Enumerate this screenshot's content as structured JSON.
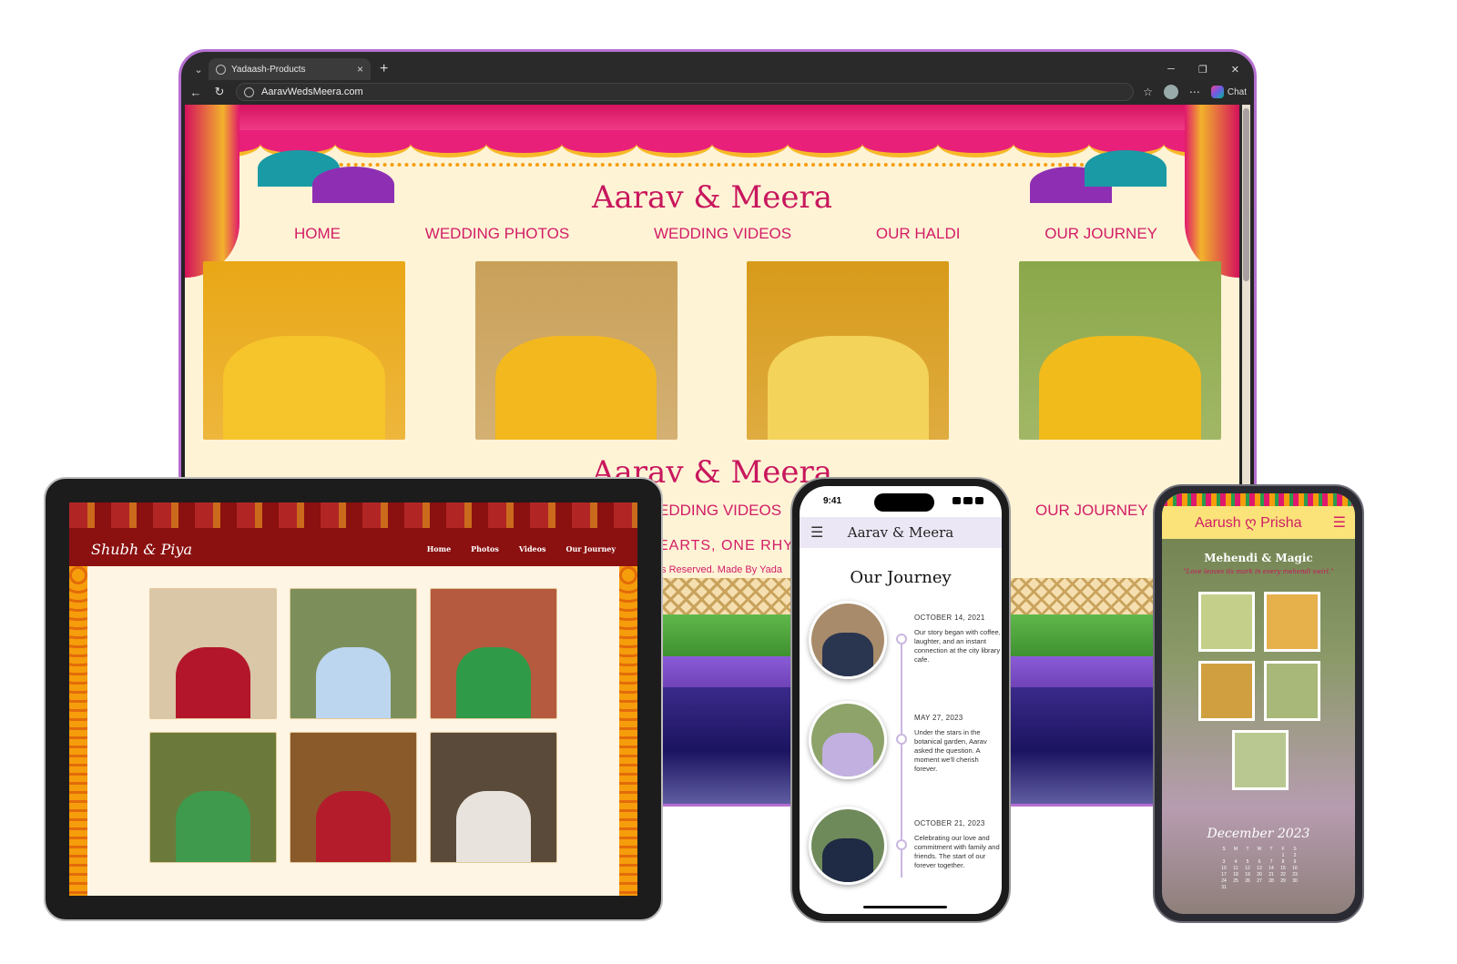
{
  "browser": {
    "tab_title": "Yadaash-Products",
    "url": "AaravWedsMeera.com",
    "chat_label": "Chat"
  },
  "desktop_site": {
    "title": "Aarav & Meera",
    "nav": [
      "HOME",
      "WEDDING PHOTOS",
      "WEDDING VIDEOS",
      "OUR HALDI",
      "OUR JOURNEY"
    ],
    "photos": [
      {
        "bg": "#e9a716",
        "fig": "#f6c42b"
      },
      {
        "bg": "#c9a05a",
        "fig": "#f2b81e"
      },
      {
        "bg": "#d79a1a",
        "fig": "#f4d35a"
      },
      {
        "bg": "#8aa84a",
        "fig": "#f1bb1c"
      }
    ],
    "title_repeat": "Aarav & Meera",
    "nav_repeat_left": "EDDING VIDEOS",
    "nav_repeat_right": "OUR JOURNEY",
    "tagline_fragment": "EARTS, ONE RHYT",
    "rights_fragment": "ts Reserved. Made By Yada"
  },
  "tablet_site": {
    "brand": "Shubh & Piya",
    "nav": [
      "Home",
      "Photos",
      "Videos",
      "Our Journey"
    ],
    "photos": [
      {
        "bg": "#d9c7a8",
        "fig": "#b3162b"
      },
      {
        "bg": "#7c8f5a",
        "fig": "#bcd6f0"
      },
      {
        "bg": "#b55a3f",
        "fig": "#2f9a48"
      },
      {
        "bg": "#6b7a3a",
        "fig": "#3f9a4e"
      },
      {
        "bg": "#8a5a2a",
        "fig": "#b41c2c"
      },
      {
        "bg": "#5a4a3a",
        "fig": "#e8e3dc"
      }
    ]
  },
  "phone_journey": {
    "time": "9:41",
    "title": "Aarav & Meera",
    "heading": "Our Journey",
    "items": [
      {
        "date": "OCTOBER 14, 2021",
        "text": "Our story began with coffee, laughter, and an instant connection at the city library cafe.",
        "bg": "#a88b6a",
        "fig": "#2a3550"
      },
      {
        "date": "MAY 27, 2023",
        "text": "Under the stars in the botanical garden, Aarav asked the question. A moment we'll cherish forever.",
        "bg": "#8ea36a",
        "fig": "#c2b0e0"
      },
      {
        "date": "OCTOBER 21, 2023",
        "text": "Celebrating our love and commitment with family and friends. The start of our forever together.",
        "bg": "#6f8a5a",
        "fig": "#1f2a44"
      }
    ]
  },
  "phone_mehendi": {
    "title": "Aarush ღ Prisha",
    "subtitle": "Mehendi & Magic",
    "quote": "\"Love leaves its mark in every mehendi swirl.\"",
    "photos": [
      "#c4d08a",
      "#e6b04a",
      "#d0a040",
      "#a8b878"
    ],
    "single_photo": "#b8c890",
    "month": "December 2023",
    "calendar": [
      "S",
      "M",
      "T",
      "W",
      "T",
      "F",
      "S",
      "",
      "",
      "",
      "",
      "",
      "1",
      "2",
      "3",
      "4",
      "5",
      "6",
      "7",
      "8",
      "9",
      "10",
      "11",
      "12",
      "13",
      "14",
      "15",
      "16",
      "17",
      "18",
      "19",
      "20",
      "21",
      "22",
      "23",
      "24",
      "25",
      "26",
      "27",
      "28",
      "29",
      "30",
      "31"
    ]
  }
}
